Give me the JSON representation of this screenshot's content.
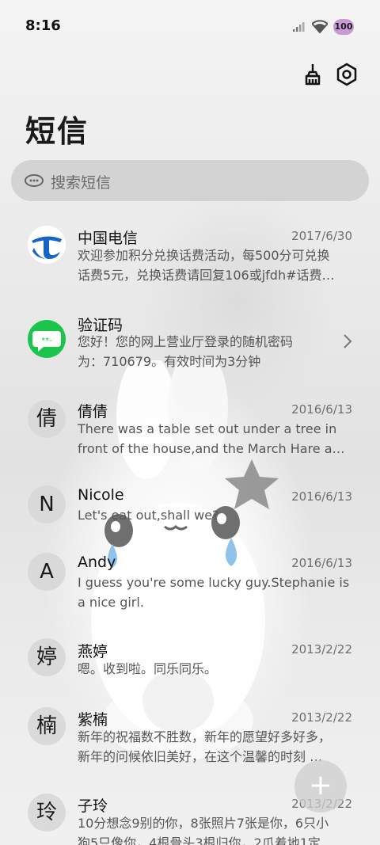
{
  "status_bar": {
    "time": "8:16",
    "battery": "100"
  },
  "header": {
    "title": "短信",
    "clean_icon": "broom-icon",
    "settings_icon": "gear-icon"
  },
  "search": {
    "placeholder": "搜索短信"
  },
  "messages": [
    {
      "name": "中国电信",
      "date": "2017/6/30",
      "line1": "欢迎参加积分兑换话费活动，每500分可兑换",
      "line2": "话费5元，兑换话费请回复106或jfdh#话费…",
      "avatar": "telecom-logo"
    },
    {
      "name": "验证码",
      "date": "",
      "line1": "您好！您的网上营业厅登录的随机密码",
      "line2": "为：710679。有效时间为3分钟",
      "avatar": "chat-bubble-icon",
      "avatar_text": "**-"
    },
    {
      "name": "倩倩",
      "date": "2016/6/13",
      "line1": "There was a table set out under a tree in",
      "line2": "front of the house,and the March Hare an…",
      "avatar_text": "倩"
    },
    {
      "name": "Nicole",
      "date": "2016/6/13",
      "line1": "Let's eat out,shall we?",
      "line2": "",
      "avatar_text": "N"
    },
    {
      "name": "Andy",
      "date": "2016/6/13",
      "line1": "I guess you're some lucky guy.Stephanie is",
      "line2": "a nice girl.",
      "avatar_text": "A"
    },
    {
      "name": "燕婷",
      "date": "2013/2/22",
      "line1": "嗯。收到啦。同乐同乐。",
      "line2": "",
      "avatar_text": "婷"
    },
    {
      "name": "紫楠",
      "date": "2013/2/22",
      "line1": "新年的祝福数不胜数，新年的愿望好多好多，",
      "line2": "新年的问候依旧美好，在这个温馨的时刻 …",
      "avatar_text": "楠"
    },
    {
      "name": "子玲",
      "date": "2013/2/22",
      "line1": "10分想念9别的你，8张照片7张是你，6只小",
      "line2": "狗5只像你，4根骨头3根归你，2爪着地1定",
      "avatar_text": "玲"
    }
  ],
  "fab": {
    "label": "+"
  },
  "colors": {
    "telecom_blue": "#1565c8",
    "verify_green": "#1bc44a",
    "avatar_bg": "#d7d7d7",
    "battery": "#c99ad6"
  }
}
